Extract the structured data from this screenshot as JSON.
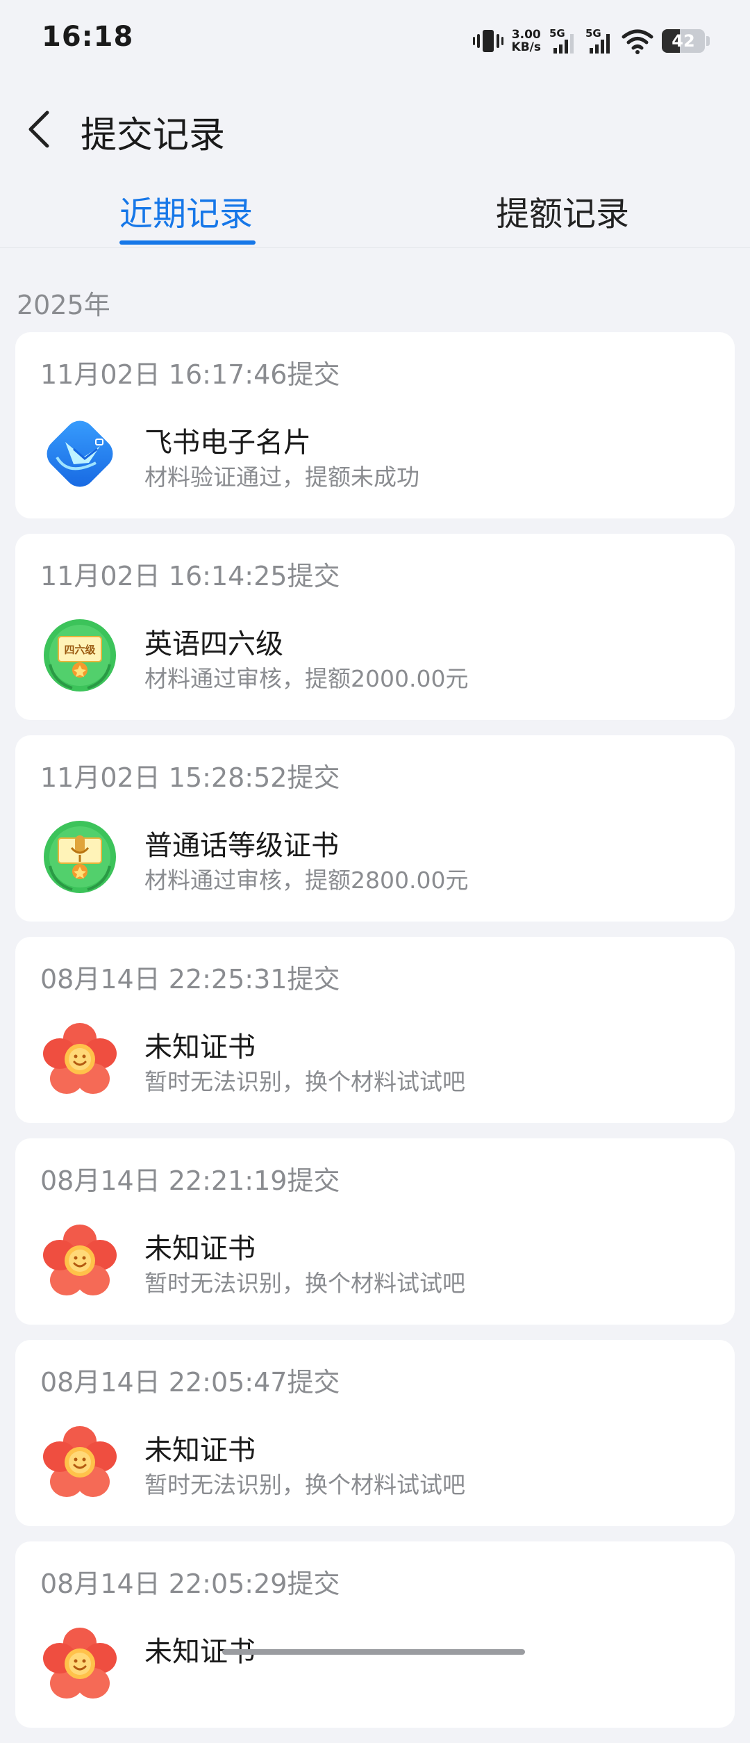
{
  "status_bar": {
    "time": "16:18",
    "net_speed_value": "3.00",
    "net_speed_unit": "KB/s",
    "signal_1_label": "5G",
    "signal_2_label": "5G",
    "battery": "42",
    "battery_level": 42
  },
  "header": {
    "title": "提交记录",
    "back_icon": "chevron-left-icon"
  },
  "tabs": [
    {
      "label": "近期记录",
      "active": true
    },
    {
      "label": "提额记录",
      "active": false
    }
  ],
  "year_label": "2025年",
  "records": [
    {
      "time": "11月02日 16:17:46提交",
      "name": "飞书电子名片",
      "desc": "材料验证通过，提额未成功",
      "icon": "feishu-card-icon"
    },
    {
      "time": "11月02日 16:14:25提交",
      "name": "英语四六级",
      "desc": "材料通过审核，提额2000.00元",
      "icon": "cet-badge-icon",
      "badge_text": "四六级"
    },
    {
      "time": "11月02日 15:28:52提交",
      "name": "普通话等级证书",
      "desc": "材料通过审核，提额2800.00元",
      "icon": "mandarin-badge-icon"
    },
    {
      "time": "08月14日 22:25:31提交",
      "name": "未知证书",
      "desc": "暂时无法识别，换个材料试试吧",
      "icon": "flower-icon"
    },
    {
      "time": "08月14日 22:21:19提交",
      "name": "未知证书",
      "desc": "暂时无法识别，换个材料试试吧",
      "icon": "flower-icon"
    },
    {
      "time": "08月14日 22:05:47提交",
      "name": "未知证书",
      "desc": "暂时无法识别，换个材料试试吧",
      "icon": "flower-icon"
    },
    {
      "time": "08月14日 22:05:29提交",
      "name": "未知证书",
      "desc": "",
      "icon": "flower-icon"
    }
  ],
  "colors": {
    "accent": "#1677e8",
    "background": "#f2f3f7",
    "secondary_text": "#8a8c90"
  }
}
